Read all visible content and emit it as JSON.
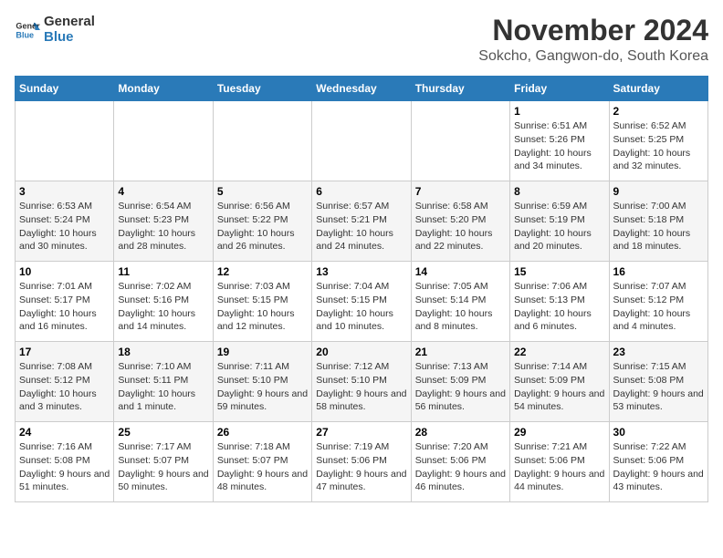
{
  "header": {
    "logo_general": "General",
    "logo_blue": "Blue",
    "month_title": "November 2024",
    "location": "Sokcho, Gangwon-do, South Korea"
  },
  "days_of_week": [
    "Sunday",
    "Monday",
    "Tuesday",
    "Wednesday",
    "Thursday",
    "Friday",
    "Saturday"
  ],
  "weeks": [
    [
      {
        "day": "",
        "info": ""
      },
      {
        "day": "",
        "info": ""
      },
      {
        "day": "",
        "info": ""
      },
      {
        "day": "",
        "info": ""
      },
      {
        "day": "",
        "info": ""
      },
      {
        "day": "1",
        "info": "Sunrise: 6:51 AM\nSunset: 5:26 PM\nDaylight: 10 hours and 34 minutes."
      },
      {
        "day": "2",
        "info": "Sunrise: 6:52 AM\nSunset: 5:25 PM\nDaylight: 10 hours and 32 minutes."
      }
    ],
    [
      {
        "day": "3",
        "info": "Sunrise: 6:53 AM\nSunset: 5:24 PM\nDaylight: 10 hours and 30 minutes."
      },
      {
        "day": "4",
        "info": "Sunrise: 6:54 AM\nSunset: 5:23 PM\nDaylight: 10 hours and 28 minutes."
      },
      {
        "day": "5",
        "info": "Sunrise: 6:56 AM\nSunset: 5:22 PM\nDaylight: 10 hours and 26 minutes."
      },
      {
        "day": "6",
        "info": "Sunrise: 6:57 AM\nSunset: 5:21 PM\nDaylight: 10 hours and 24 minutes."
      },
      {
        "day": "7",
        "info": "Sunrise: 6:58 AM\nSunset: 5:20 PM\nDaylight: 10 hours and 22 minutes."
      },
      {
        "day": "8",
        "info": "Sunrise: 6:59 AM\nSunset: 5:19 PM\nDaylight: 10 hours and 20 minutes."
      },
      {
        "day": "9",
        "info": "Sunrise: 7:00 AM\nSunset: 5:18 PM\nDaylight: 10 hours and 18 minutes."
      }
    ],
    [
      {
        "day": "10",
        "info": "Sunrise: 7:01 AM\nSunset: 5:17 PM\nDaylight: 10 hours and 16 minutes."
      },
      {
        "day": "11",
        "info": "Sunrise: 7:02 AM\nSunset: 5:16 PM\nDaylight: 10 hours and 14 minutes."
      },
      {
        "day": "12",
        "info": "Sunrise: 7:03 AM\nSunset: 5:15 PM\nDaylight: 10 hours and 12 minutes."
      },
      {
        "day": "13",
        "info": "Sunrise: 7:04 AM\nSunset: 5:15 PM\nDaylight: 10 hours and 10 minutes."
      },
      {
        "day": "14",
        "info": "Sunrise: 7:05 AM\nSunset: 5:14 PM\nDaylight: 10 hours and 8 minutes."
      },
      {
        "day": "15",
        "info": "Sunrise: 7:06 AM\nSunset: 5:13 PM\nDaylight: 10 hours and 6 minutes."
      },
      {
        "day": "16",
        "info": "Sunrise: 7:07 AM\nSunset: 5:12 PM\nDaylight: 10 hours and 4 minutes."
      }
    ],
    [
      {
        "day": "17",
        "info": "Sunrise: 7:08 AM\nSunset: 5:12 PM\nDaylight: 10 hours and 3 minutes."
      },
      {
        "day": "18",
        "info": "Sunrise: 7:10 AM\nSunset: 5:11 PM\nDaylight: 10 hours and 1 minute."
      },
      {
        "day": "19",
        "info": "Sunrise: 7:11 AM\nSunset: 5:10 PM\nDaylight: 9 hours and 59 minutes."
      },
      {
        "day": "20",
        "info": "Sunrise: 7:12 AM\nSunset: 5:10 PM\nDaylight: 9 hours and 58 minutes."
      },
      {
        "day": "21",
        "info": "Sunrise: 7:13 AM\nSunset: 5:09 PM\nDaylight: 9 hours and 56 minutes."
      },
      {
        "day": "22",
        "info": "Sunrise: 7:14 AM\nSunset: 5:09 PM\nDaylight: 9 hours and 54 minutes."
      },
      {
        "day": "23",
        "info": "Sunrise: 7:15 AM\nSunset: 5:08 PM\nDaylight: 9 hours and 53 minutes."
      }
    ],
    [
      {
        "day": "24",
        "info": "Sunrise: 7:16 AM\nSunset: 5:08 PM\nDaylight: 9 hours and 51 minutes."
      },
      {
        "day": "25",
        "info": "Sunrise: 7:17 AM\nSunset: 5:07 PM\nDaylight: 9 hours and 50 minutes."
      },
      {
        "day": "26",
        "info": "Sunrise: 7:18 AM\nSunset: 5:07 PM\nDaylight: 9 hours and 48 minutes."
      },
      {
        "day": "27",
        "info": "Sunrise: 7:19 AM\nSunset: 5:06 PM\nDaylight: 9 hours and 47 minutes."
      },
      {
        "day": "28",
        "info": "Sunrise: 7:20 AM\nSunset: 5:06 PM\nDaylight: 9 hours and 46 minutes."
      },
      {
        "day": "29",
        "info": "Sunrise: 7:21 AM\nSunset: 5:06 PM\nDaylight: 9 hours and 44 minutes."
      },
      {
        "day": "30",
        "info": "Sunrise: 7:22 AM\nSunset: 5:06 PM\nDaylight: 9 hours and 43 minutes."
      }
    ]
  ]
}
